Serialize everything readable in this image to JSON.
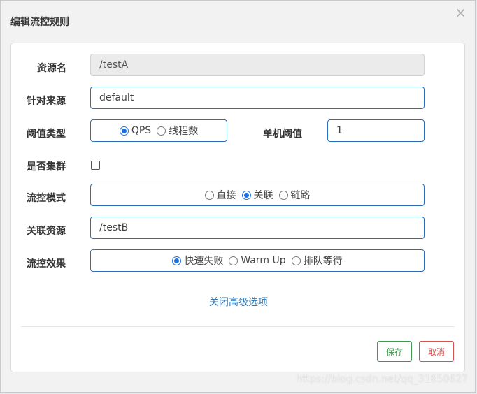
{
  "dialog": {
    "title": "编辑流控规则",
    "close_glyph": "×"
  },
  "form": {
    "resource": {
      "label": "资源名",
      "value": "/testA"
    },
    "limit_app": {
      "label": "针对来源",
      "value": "default"
    },
    "grade": {
      "label": "阈值类型",
      "options": [
        {
          "label": "QPS",
          "checked": true
        },
        {
          "label": "线程数",
          "checked": false
        }
      ]
    },
    "count": {
      "label": "单机阈值",
      "value": "1"
    },
    "cluster": {
      "label": "是否集群",
      "checked": false
    },
    "strategy": {
      "label": "流控模式",
      "options": [
        {
          "label": "直接",
          "checked": false
        },
        {
          "label": "关联",
          "checked": true
        },
        {
          "label": "链路",
          "checked": false
        }
      ]
    },
    "ref_resource": {
      "label": "关联资源",
      "value": "/testB"
    },
    "control_behavior": {
      "label": "流控效果",
      "options": [
        {
          "label": "快速失败",
          "checked": true
        },
        {
          "label": "Warm Up",
          "checked": false
        },
        {
          "label": "排队等待",
          "checked": false
        }
      ]
    },
    "advanced_toggle": "关闭高级选项"
  },
  "footer": {
    "save_label": "保存",
    "cancel_label": "取消"
  },
  "watermark": "https://blog.csdn.net/qq_31850627",
  "colors": {
    "accent": "#2a6ebb",
    "save": "#3c9a4a",
    "cancel": "#d9534f",
    "link": "#337ab7"
  }
}
